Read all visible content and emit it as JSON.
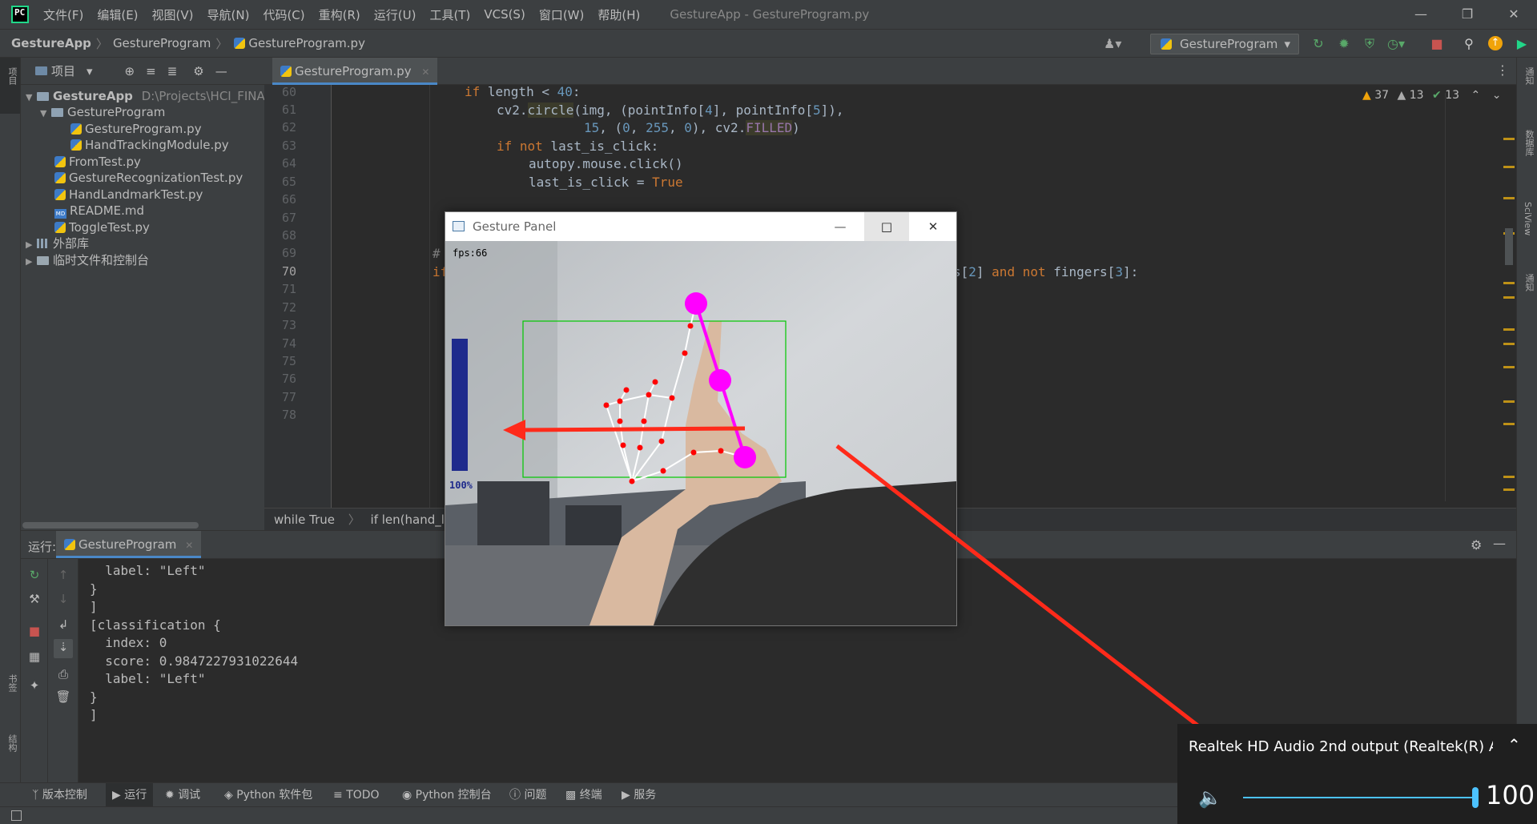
{
  "menu": [
    "文件(F)",
    "编辑(E)",
    "视图(V)",
    "导航(N)",
    "代码(C)",
    "重构(R)",
    "运行(U)",
    "工具(T)",
    "VCS(S)",
    "窗口(W)",
    "帮助(H)"
  ],
  "window_title": "GestureApp - GestureProgram.py",
  "breadcrumb": [
    "GestureApp",
    "GestureProgram",
    "GestureProgram.py"
  ],
  "run_config": "GestureProgram",
  "project": {
    "header": "项目",
    "root": "GestureApp",
    "root_path": "D:\\Projects\\HCI_FINA",
    "folder": "GestureProgram",
    "files_in_folder": [
      "GestureProgram.py",
      "HandTrackingModule.py"
    ],
    "files": [
      "FromTest.py",
      "GestureRecognizationTest.py",
      "HandLandmarkTest.py",
      "README.md",
      "ToggleTest.py"
    ],
    "external_libs": "外部库",
    "scratches": "临时文件和控制台"
  },
  "left_stripe_labels": [
    "项目",
    "书签",
    "结构"
  ],
  "right_stripe_labels": [
    "通知",
    "数据库",
    "SciView",
    "通知"
  ],
  "editor": {
    "tab": "GestureProgram.py",
    "line_numbers": [
      "60",
      "61",
      "62",
      "63",
      "64",
      "65",
      "66",
      "67",
      "68",
      "69",
      "70",
      "71",
      "72",
      "73",
      "74",
      "75",
      "76",
      "77",
      "78"
    ],
    "warnings": "37",
    "weak_warnings": "13",
    "typos": "13",
    "code": {
      "l60_kw": "if",
      "l60_rest": " length < ",
      "l60_num": "40",
      "l60_end": ":",
      "l61_a": "cv2.",
      "l61_b": "circle",
      "l61_c": "(img, (pointInfo[",
      "l61_n1": "4",
      "l61_d": "], pointInfo[",
      "l61_n2": "5",
      "l61_e": "]),",
      "l62_n1": "15",
      "l62_a": ", (",
      "l62_n2": "0",
      "l62_n3": "255",
      "l62_n4": "0",
      "l62_b": "), cv2.",
      "l62_c": "FILLED",
      "l62_d": ")",
      "l63_kw": "if not",
      "l63_rest": " last_is_click:",
      "l64": "autopy.mouse.click()",
      "l65_a": "last_is_click = ",
      "l65_kw": "True",
      "l69": "#",
      "l70_kw": "if",
      "l70_a": "s[",
      "l70_n": "2",
      "l70_b": "] ",
      "l70_kw2": "and not",
      "l70_c": " fingers[",
      "l70_n2": "3",
      "l70_d": "]:"
    },
    "breadcrumbs": [
      "while True",
      "if len(hand_lab"
    ]
  },
  "run": {
    "label": "运行:",
    "tab": "GestureProgram",
    "console": [
      "  label: \"Left\"",
      "}",
      "]",
      "[classification {",
      "  index: 0",
      "  score: 0.9847227931022644",
      "  label: \"Left\"",
      "}",
      "]"
    ]
  },
  "bottom_tabs": [
    "版本控制",
    "运行",
    "调试",
    "Python 软件包",
    "TODO",
    "Python 控制台",
    "问题",
    "终端",
    "服务"
  ],
  "gesture_panel": {
    "title": "Gesture Panel",
    "fps": "fps:66",
    "volume_percent_label": "100%",
    "volume_level": 100
  },
  "volume_flyout": {
    "device": "Realtek HD Audio 2nd output (Realtek(R) Aud...",
    "value": "100",
    "level": 100
  },
  "colors": {
    "accent": "#4a88c7",
    "landmark": "#ff0000",
    "highlight": "#ff00ff",
    "bbox": "#00c800",
    "volume_bar": "#1e2a8c",
    "arrow": "#ff2a1a"
  }
}
